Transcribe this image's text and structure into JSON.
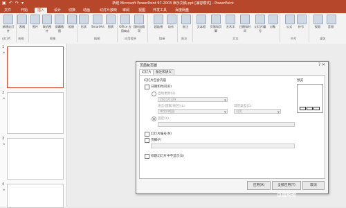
{
  "window": {
    "title": "新建 Microsoft PowerPoint 97-2003 演示文稿.ppt [兼容模式] - PowerPoint"
  },
  "ribbon_tabs": [
    "文件",
    "开始",
    "插入",
    "设计",
    "切换",
    "动画",
    "幻灯片放映",
    "审阅",
    "视图",
    "开发工具",
    "百度网盘"
  ],
  "ribbon_buttons": [
    "新建幻灯片",
    "表格",
    "图片",
    "联机图片",
    "屏幕截图",
    "相册",
    "形状",
    "SmartArt",
    "图表",
    "Office 应用商店",
    "我的加载项",
    "超链接",
    "动作",
    "批注",
    "文本框",
    "页眉和页脚",
    "艺术字",
    "日期和时间",
    "幻灯片编号",
    "对象",
    "公式",
    "符号",
    "视频",
    "音频"
  ],
  "ribbon_groups": [
    "幻灯片",
    "表格",
    "图像",
    "插图",
    "应用程序",
    "链接",
    "批注",
    "文本",
    "符号",
    "媒体"
  ],
  "slides": [
    {
      "num": "1"
    },
    {
      "num": "2"
    },
    {
      "num": "3"
    },
    {
      "num": "4"
    }
  ],
  "dialog": {
    "title": "页眉和页脚",
    "close": "?  ✕",
    "tab_slide": "幻灯片",
    "tab_notes": "备注和讲义",
    "section_include": "幻灯片包含内容",
    "date_time": "日期和时间(D)",
    "auto_update": "自动更新(U)",
    "date_value": "2021/1/29",
    "language_label": "语言(国家/地区)(L):",
    "calendar_label": "日历类型(C):",
    "language_value": "中文(中国)",
    "calendar_value": "公历",
    "fixed": "固定(X)",
    "slide_number": "幻灯片编号(N)",
    "footer": "页脚(F)",
    "no_title": "标题幻灯片中不显示(S)",
    "preview": "预览",
    "btn_apply": "应用(A)",
    "btn_apply_all": "全部应用(Y)",
    "btn_cancel": "取消"
  },
  "watermark": "百度经验"
}
